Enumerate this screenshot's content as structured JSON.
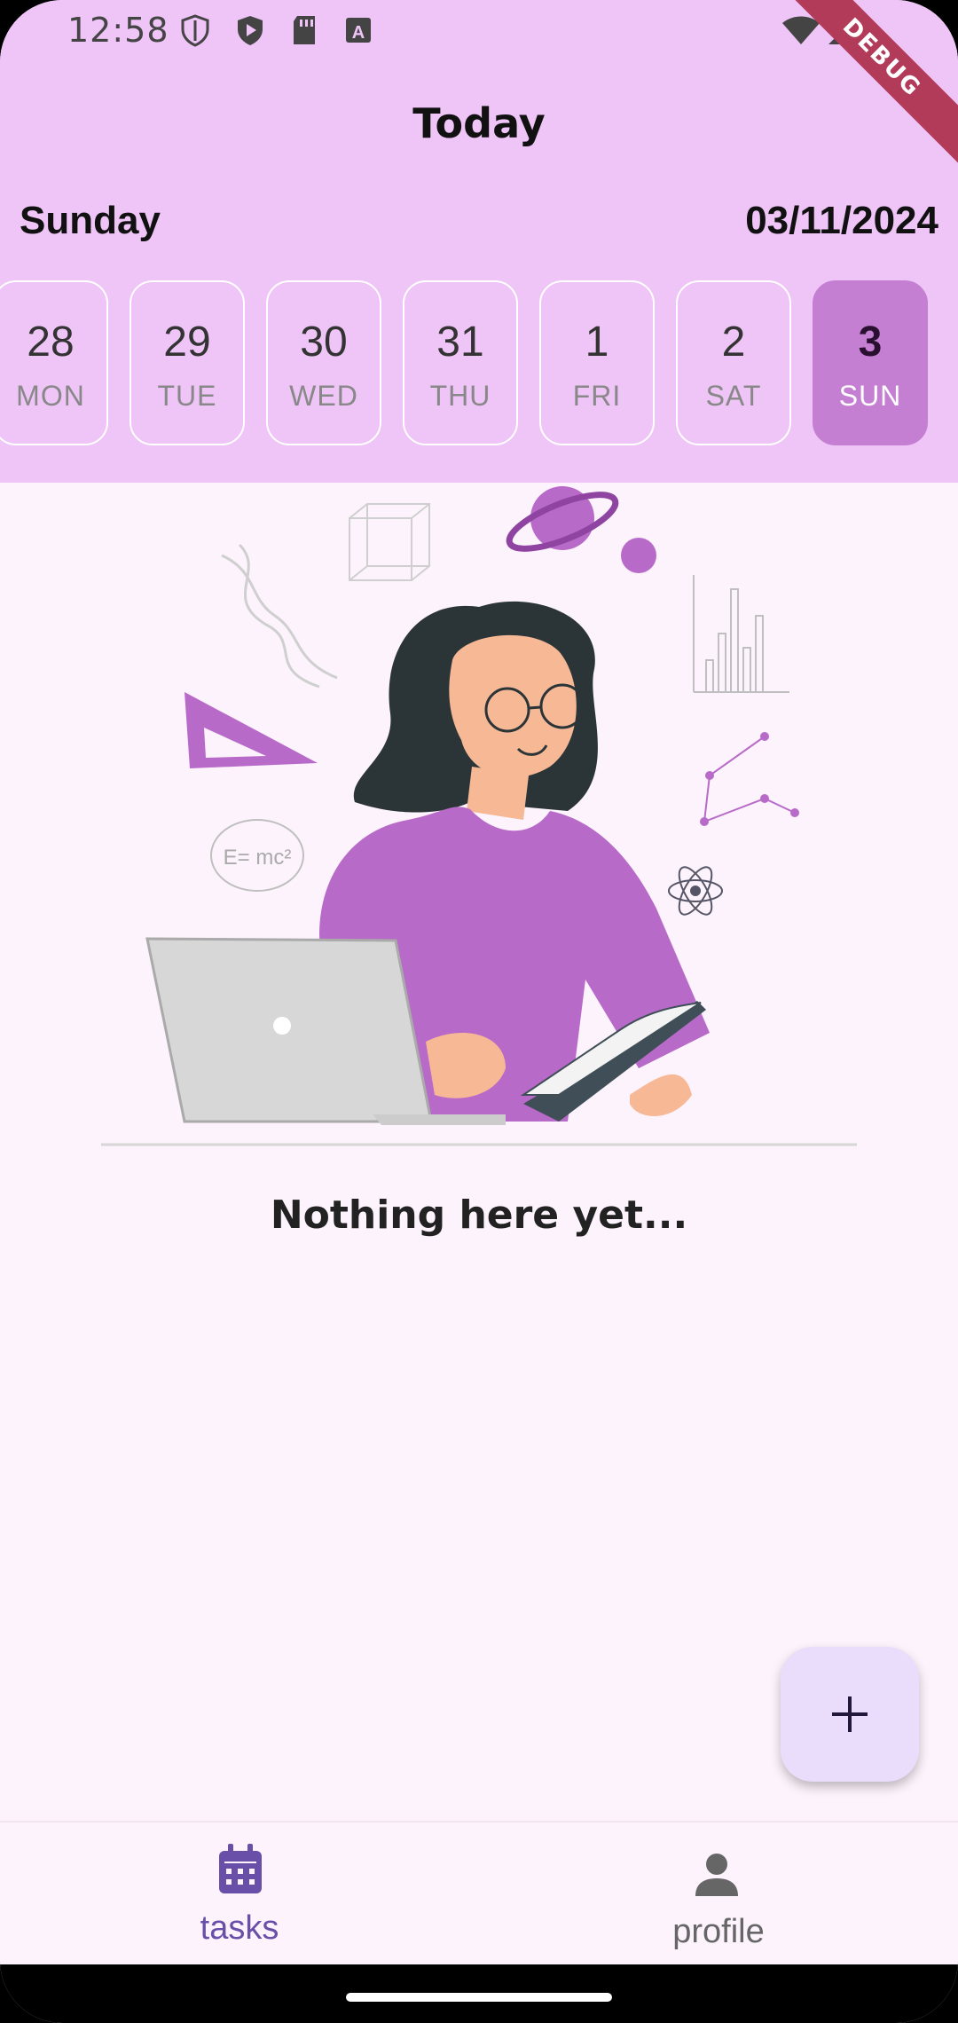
{
  "status_bar": {
    "time": "12:58",
    "icons": [
      "shield-icon",
      "play-shield-icon",
      "sd-card-icon",
      "keyboard-a-icon",
      "wifi-icon",
      "signal-icon"
    ],
    "debug_banner": "DEBUG"
  },
  "header": {
    "title": "Today",
    "day_name": "Sunday",
    "date": "03/11/2024",
    "days": [
      {
        "num": "28",
        "abbr": "MON",
        "selected": false
      },
      {
        "num": "29",
        "abbr": "TUE",
        "selected": false
      },
      {
        "num": "30",
        "abbr": "WED",
        "selected": false
      },
      {
        "num": "31",
        "abbr": "THU",
        "selected": false
      },
      {
        "num": "1",
        "abbr": "FRI",
        "selected": false
      },
      {
        "num": "2",
        "abbr": "SAT",
        "selected": false
      },
      {
        "num": "3",
        "abbr": "SUN",
        "selected": true
      }
    ]
  },
  "main": {
    "empty_message": "Nothing here yet...",
    "illustration_formula": "E= mc²"
  },
  "fab": {
    "icon": "plus-icon"
  },
  "bottom_nav": {
    "items": [
      {
        "label": "tasks",
        "icon": "calendar-icon",
        "active": true
      },
      {
        "label": "profile",
        "icon": "person-icon",
        "active": false
      }
    ]
  },
  "colors": {
    "header_bg": "#EFC4F7",
    "page_bg": "#FDF3FC",
    "selected_day": "#C47ED2",
    "accent": "#6A4FA8",
    "fab_bg": "#EADDFC"
  }
}
